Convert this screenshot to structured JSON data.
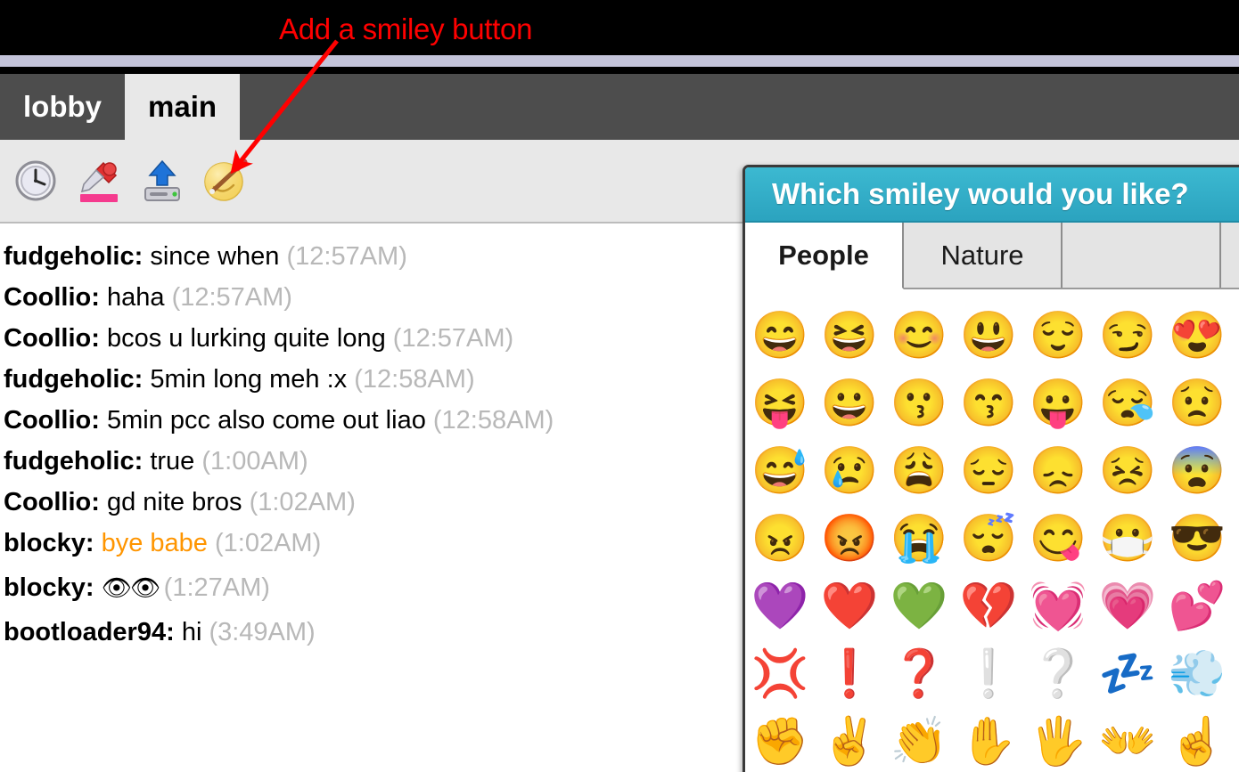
{
  "annotation": {
    "label": "Add a smiley button",
    "color": "#ff0000",
    "arrow_from": "378,48",
    "arrow_to": "261,191"
  },
  "room_tabs": [
    {
      "label": "lobby",
      "active": false
    },
    {
      "label": "main",
      "active": true
    }
  ],
  "toolbar": {
    "buttons": [
      {
        "name": "history-clock-button",
        "icon": "clock-icon",
        "label": "History"
      },
      {
        "name": "color-picker-button",
        "icon": "eyedropper-icon",
        "label": "Text color"
      },
      {
        "name": "upload-button",
        "icon": "upload-icon",
        "label": "Upload"
      },
      {
        "name": "add-smiley-button",
        "icon": "smiley-paintbrush-icon",
        "label": "Add a smiley"
      }
    ]
  },
  "chat": {
    "messages": [
      {
        "nick": "fudgeholic:",
        "body": "since when",
        "time": "(12:57AM)",
        "highlight": false,
        "emoji": false
      },
      {
        "nick": "Coollio:",
        "body": "haha",
        "time": "(12:57AM)",
        "highlight": false,
        "emoji": false
      },
      {
        "nick": "Coollio:",
        "body": "bcos u lurking quite long",
        "time": "(12:57AM)",
        "highlight": false,
        "emoji": false
      },
      {
        "nick": "fudgeholic:",
        "body": "5min long meh :x",
        "time": "(12:58AM)",
        "highlight": false,
        "emoji": false
      },
      {
        "nick": "Coollio:",
        "body": "5min pcc also come out liao",
        "time": "(12:58AM)",
        "highlight": false,
        "emoji": false
      },
      {
        "nick": "fudgeholic:",
        "body": "true",
        "time": "(1:00AM)",
        "highlight": false,
        "emoji": false
      },
      {
        "nick": "Coollio:",
        "body": "gd nite bros",
        "time": "(1:02AM)",
        "highlight": false,
        "emoji": false
      },
      {
        "nick": "blocky:",
        "body": "bye babe",
        "time": "(1:02AM)",
        "highlight": true,
        "emoji": false
      },
      {
        "nick": "blocky:",
        "body": "👁👁",
        "time": "(1:27AM)",
        "highlight": false,
        "emoji": true
      },
      {
        "nick": "bootloader94:",
        "body": "hi",
        "time": "(3:49AM)",
        "highlight": false,
        "emoji": false
      }
    ]
  },
  "smiley_dialog": {
    "title": "Which smiley would you like?",
    "header_color": "#2ba3bf",
    "tabs": [
      {
        "label": "People",
        "active": true
      },
      {
        "label": "Nature",
        "active": false
      },
      {
        "label": "",
        "active": false
      }
    ],
    "grid": [
      [
        "😄",
        "😆",
        "😊",
        "😃",
        "😌",
        "😏",
        "😍"
      ],
      [
        "😝",
        "😀",
        "😗",
        "😙",
        "😛",
        "😪",
        "😟"
      ],
      [
        "😅",
        "😢",
        "😩",
        "😔",
        "😞",
        "😣",
        "😨"
      ],
      [
        "😠",
        "😡",
        "😭",
        "😴",
        "😋",
        "😷",
        "😎"
      ],
      [
        "💜",
        "❤️",
        "💚",
        "💔",
        "💓",
        "💗",
        "💕"
      ],
      [
        "💢",
        "❗",
        "❓",
        "❕",
        "❔",
        "💤",
        "💨"
      ],
      [
        "✊",
        "✌️",
        "👏",
        "✋",
        "🖐",
        "👐",
        "☝️"
      ]
    ]
  }
}
